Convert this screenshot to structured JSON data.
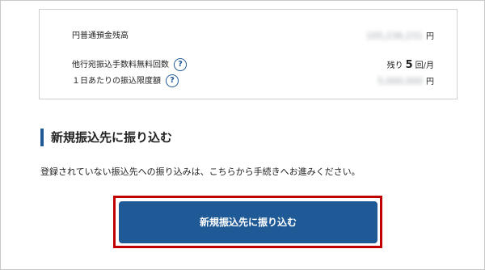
{
  "account": {
    "balance_label": "円普通預金残高",
    "balance_value": "105,236,231",
    "balance_unit": "円",
    "fee_free_label": "他行宛振込手数料無料回数",
    "fee_free_prefix": "残り",
    "fee_free_count": "5",
    "fee_free_unit": "回/月",
    "daily_limit_label": "１日あたりの振込限度額",
    "daily_limit_value": "5,000,000",
    "daily_limit_unit": "円",
    "help_icon_glyph": "?"
  },
  "section": {
    "heading": "新規振込先に振り込む",
    "description": "登録されていない振込先への振り込みは、こちらから手続きへお進みください。"
  },
  "button": {
    "label": "新規振込先に振り込む"
  },
  "colors": {
    "accent": "#1f5a97",
    "highlight": "#c00000"
  }
}
